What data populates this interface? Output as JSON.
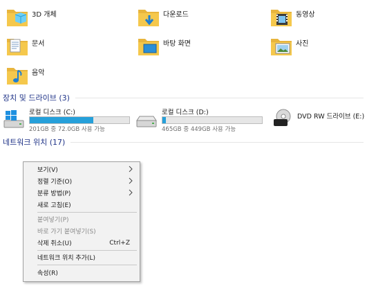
{
  "folders": [
    {
      "label": "3D 개체",
      "icon": "3d-objects-folder-icon"
    },
    {
      "label": "다운로드",
      "icon": "downloads-folder-icon"
    },
    {
      "label": "동영상",
      "icon": "videos-folder-icon"
    },
    {
      "label": "문서",
      "icon": "documents-folder-icon"
    },
    {
      "label": "바탕 화면",
      "icon": "desktop-folder-icon"
    },
    {
      "label": "사진",
      "icon": "pictures-folder-icon"
    },
    {
      "label": "음악",
      "icon": "music-folder-icon"
    }
  ],
  "devices_section": {
    "title": "장치 및 드라이브 (3)"
  },
  "drives": [
    {
      "name": "로컬 디스크 (C:)",
      "size_text": "201GB 중 72.0GB 사용 가능",
      "used_fraction": 0.64,
      "icon": "windows-drive-icon"
    },
    {
      "name": "로컬 디스크 (D:)",
      "size_text": "465GB 중 449GB 사용 가능",
      "used_fraction": 0.035,
      "icon": "hard-drive-icon"
    },
    {
      "name": "DVD RW 드라이브 (E:)",
      "icon": "dvd-drive-icon"
    }
  ],
  "network_section": {
    "title": "네트워크 위치 (17)"
  },
  "context_menu": {
    "items": [
      {
        "label": "보기(V)",
        "submenu": true,
        "enabled": true
      },
      {
        "label": "정렬 기준(O)",
        "submenu": true,
        "enabled": true
      },
      {
        "label": "분류 방법(P)",
        "submenu": true,
        "enabled": true
      },
      {
        "label": "새로 고침(E)",
        "enabled": true
      },
      {
        "label": "붙여넣기(P)",
        "enabled": false
      },
      {
        "label": "바로 가기 붙여넣기(S)",
        "enabled": false
      },
      {
        "label": "삭제 취소(U)",
        "shortcut": "Ctrl+Z",
        "enabled": true
      },
      {
        "label": "네트워크 위치 추가(L)",
        "enabled": true
      },
      {
        "label": "속성(R)",
        "enabled": true
      }
    ]
  },
  "colors": {
    "section_heading": "#1e3287",
    "drive_bar_fill": "#26a0da",
    "folder_yellow": "#f5c84c"
  }
}
